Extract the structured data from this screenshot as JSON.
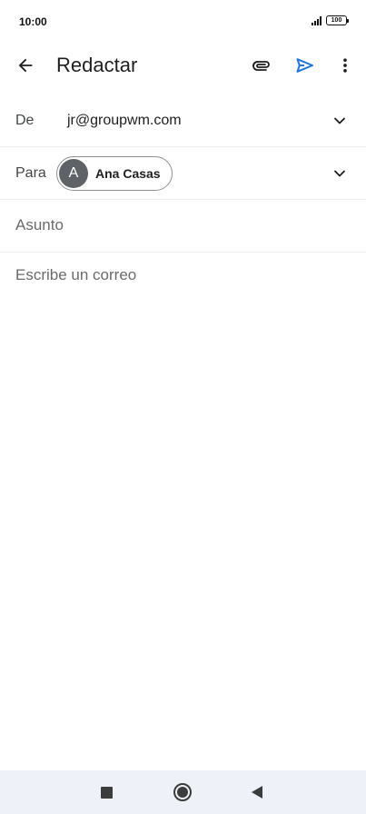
{
  "status_bar": {
    "time": "10:00",
    "battery": "100",
    "icons": [
      "signal-icon",
      "battery-icon"
    ]
  },
  "app_bar": {
    "title": "Redactar",
    "icons": [
      "arrow-back-icon",
      "paperclip-icon",
      "send-icon",
      "more-vert-icon"
    ]
  },
  "compose": {
    "from_label": "De",
    "from_value": "jr@groupwm.com",
    "to_label": "Para",
    "recipient": {
      "initial": "A",
      "name": "Ana Casas"
    },
    "subject_placeholder": "Asunto",
    "body_placeholder": "Escribe un correo"
  },
  "colors": {
    "send_accent": "#1a73e8",
    "avatar_bg": "#5f6368",
    "nav_bar_bg": "#eef1f8"
  },
  "nav_bar": {
    "icons": [
      "recents-icon",
      "home-icon",
      "back-icon"
    ]
  }
}
